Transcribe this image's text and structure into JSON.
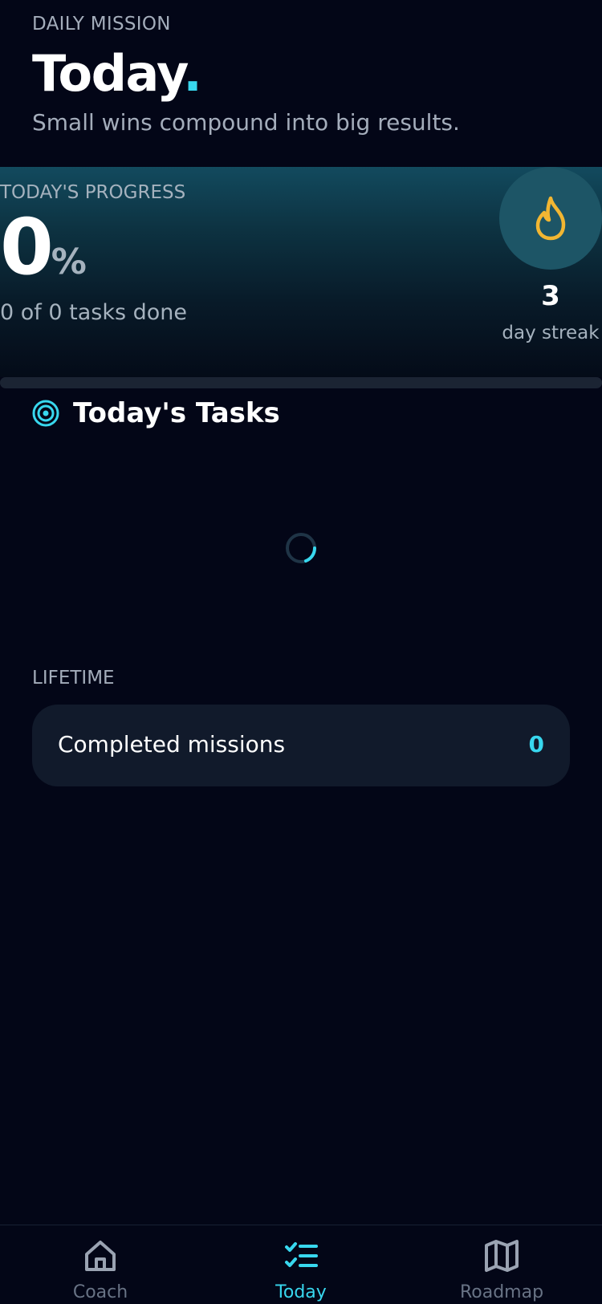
{
  "header": {
    "eyebrow": "DAILY MISSION",
    "title": "Today",
    "title_accent": ".",
    "subtitle": "Small wins compound into big results."
  },
  "progress": {
    "label": "TODAY'S PROGRESS",
    "percent": "0",
    "unit": "%",
    "summary": "0 of 0 tasks done",
    "fill_fraction": 0
  },
  "streak": {
    "icon": "flame-icon",
    "count": "3",
    "label": "day streak"
  },
  "tasks": {
    "icon": "target-icon",
    "heading": "Today's Tasks",
    "loading": true
  },
  "lifetime": {
    "label": "LIFETIME",
    "stats": [
      {
        "name": "Completed missions",
        "value": "0"
      }
    ]
  },
  "nav": {
    "items": [
      {
        "label": "Coach",
        "icon": "home-icon",
        "active": false
      },
      {
        "label": "Today",
        "icon": "checklist-icon",
        "active": true
      },
      {
        "label": "Roadmap",
        "icon": "map-icon",
        "active": false
      }
    ]
  },
  "colors": {
    "background": "#030617",
    "accent": "#38d7ee",
    "flame": "#f2b632",
    "muted_text": "#a4adbb",
    "card": "#111a2b"
  }
}
